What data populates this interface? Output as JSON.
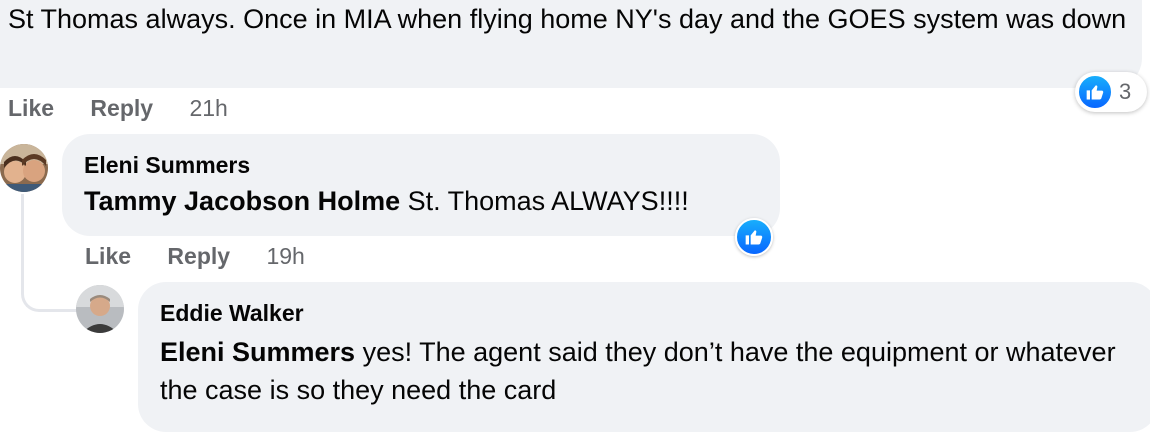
{
  "top_comment": {
    "text": "St Thomas always. Once in MIA when flying home NY's day and the GOES system was down",
    "reaction_count": "3",
    "like_label": "Like",
    "reply_label": "Reply",
    "time": "21h"
  },
  "reply1": {
    "author": "Eleni Summers",
    "mention": "Tammy Jacobson Holme",
    "text": " St. Thomas ALWAYS!!!!",
    "like_label": "Like",
    "reply_label": "Reply",
    "time": "19h"
  },
  "reply2": {
    "author": "Eddie Walker",
    "mention": "Eleni Summers",
    "text": " yes! The agent said they don’t have the equipment or whatever the case is so they need the card"
  },
  "colors": {
    "bubble": "#f0f2f5",
    "meta_text": "#65676b",
    "like_blue": "#0866ff"
  }
}
